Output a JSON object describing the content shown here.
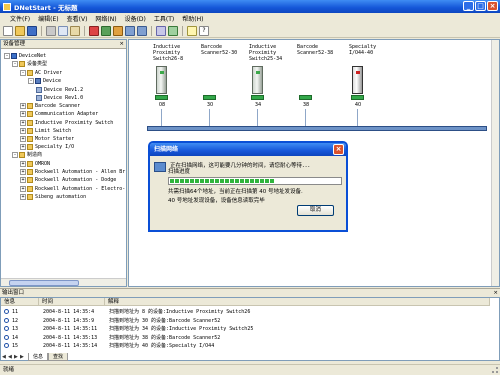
{
  "window": {
    "title": "DNetStart - 无标题"
  },
  "menu": [
    "文件(F)",
    "编辑(E)",
    "查看(V)",
    "网络(N)",
    "设备(D)",
    "工具(T)",
    "帮助(H)"
  ],
  "tree": {
    "header": "设备管理",
    "nodes": [
      {
        "label": "DeviceNet",
        "box": "-",
        "icon": "net"
      },
      {
        "label": "设备类型",
        "box": "-",
        "icon": "folder"
      },
      {
        "label": "AC Driver",
        "box": "-",
        "icon": "folder"
      },
      {
        "label": "Device",
        "box": "-",
        "icon": "dev"
      },
      {
        "label": "Device Rev1.2",
        "box": "",
        "icon": "item"
      },
      {
        "label": "Device Rev1.0",
        "box": "",
        "icon": "item"
      },
      {
        "label": "Barcode Scanner",
        "box": "+",
        "icon": "folder"
      },
      {
        "label": "Communication Adapter",
        "box": "+",
        "icon": "folder"
      },
      {
        "label": "Inductive Proximity Switch",
        "box": "+",
        "icon": "folder"
      },
      {
        "label": "Limit Switch",
        "box": "+",
        "icon": "folder"
      },
      {
        "label": "Motor Starter",
        "box": "+",
        "icon": "folder"
      },
      {
        "label": "Specialty I/O",
        "box": "+",
        "icon": "folder"
      },
      {
        "label": "制造商",
        "box": "-",
        "icon": "folder"
      },
      {
        "label": "OMRON",
        "box": "+",
        "icon": "folder"
      },
      {
        "label": "Rockwell Automation - Allen Br",
        "box": "+",
        "icon": "folder"
      },
      {
        "label": "Rockwell Automation - Dodge",
        "box": "+",
        "icon": "folder"
      },
      {
        "label": "Rockwell Automation - Electro-",
        "box": "+",
        "icon": "folder"
      },
      {
        "label": "Sibeng automation",
        "box": "+",
        "icon": "folder"
      }
    ]
  },
  "devices": [
    {
      "name": "Inductive\nProximity\nSwitch26-8",
      "address": "08"
    },
    {
      "name": "Barcode\nScanner52-30",
      "address": "30"
    },
    {
      "name": "Inductive\nProximity\nSwitch25-34",
      "address": "34"
    },
    {
      "name": "Barcode\nScanner52-38",
      "address": "38"
    },
    {
      "name": "Specialty\nI/O44-40",
      "address": "40"
    }
  ],
  "dialog": {
    "title": "扫描网络",
    "message": "正在扫描网络，这可能要几分钟的时间，请您耐心等待．．．",
    "progress_label": "扫描进度",
    "progress": 0.62,
    "line1": "共需扫描64个地址，当前正在扫描第  40  号地址发设备.",
    "line2": "40  号地址发现设备，设备信息读取完毕",
    "cancel": "取消"
  },
  "output": {
    "header": "输出窗口",
    "columns": [
      "信息",
      "时间",
      "解释"
    ],
    "rows": [
      {
        "id": "11",
        "time": "2004-8-11 14:35:4",
        "text": "扫描到地址为  8 的设备:Inductive Proximity Switch26"
      },
      {
        "id": "12",
        "time": "2004-8-11 14:35:9",
        "text": "扫描到地址为 30 的设备:Barcode Scanner52"
      },
      {
        "id": "13",
        "time": "2004-8-11 14:35:11",
        "text": "扫描到地址为 34 的设备:Inductive Proximity Switch25"
      },
      {
        "id": "14",
        "time": "2004-8-11 14:35:13",
        "text": "扫描到地址为 38 的设备:Barcode Scanner52"
      },
      {
        "id": "15",
        "time": "2004-8-11 14:35:14",
        "text": "扫描到地址为 40 的设备:Specialty I/O44"
      }
    ],
    "tabs": [
      "信息",
      "查找"
    ]
  },
  "status": "就绪"
}
